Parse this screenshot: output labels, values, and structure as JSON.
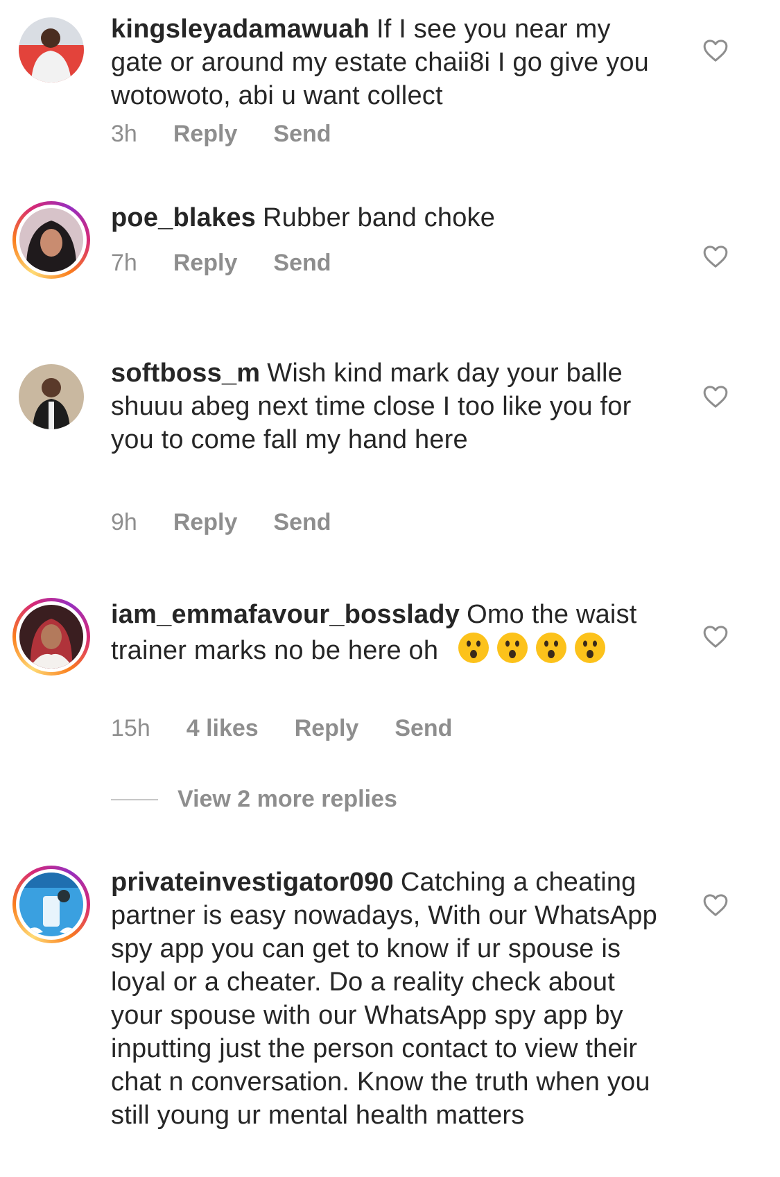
{
  "comments": [
    {
      "username": "kingsleyadamawuah",
      "text": "If I see you near my gate or around my estate chaii8i I go give you wotowoto, abi u want collect",
      "time": "3h",
      "likes": "",
      "reply_label": "Reply",
      "send_label": "Send",
      "story_ring": false,
      "icon": "heart-outline-icon"
    },
    {
      "username": "poe_blakes",
      "text": "Rubber band choke",
      "time": "7h",
      "likes": "",
      "reply_label": "Reply",
      "send_label": "Send",
      "story_ring": true,
      "icon": "heart-outline-icon"
    },
    {
      "username": "softboss_m",
      "text": "Wish kind mark day your balle shuuu abeg next time close I too like you for you to come fall my hand here",
      "time": "9h",
      "likes": "",
      "reply_label": "Reply",
      "send_label": "Send",
      "story_ring": false,
      "icon": "heart-outline-icon"
    },
    {
      "username": "iam_emmafavour_bosslady",
      "text": "Omo the waist trainer marks no be here oh",
      "emoji": [
        "hushed-face-emoji",
        "hushed-face-emoji",
        "hushed-face-emoji",
        "hushed-face-emoji"
      ],
      "time": "15h",
      "likes": "4 likes",
      "reply_label": "Reply",
      "send_label": "Send",
      "story_ring": true,
      "icon": "heart-outline-icon"
    },
    {
      "username": "privateinvestigator090",
      "text": "Catching a cheating partner is easy nowadays, With our WhatsApp spy app you can get to know if ur spouse is loyal or a cheater. Do a reality check about your spouse with our WhatsApp spy app by inputting just the person contact to view their chat n conversation. Know the truth when you still young ur mental health matters",
      "story_ring": true,
      "icon": "heart-outline-icon"
    }
  ],
  "view_more_replies": "View 2 more replies",
  "colors": {
    "text": "#262626",
    "secondary": "#8e8e8e",
    "divider": "#c7c7c7",
    "heart": "#8e8e8e"
  }
}
